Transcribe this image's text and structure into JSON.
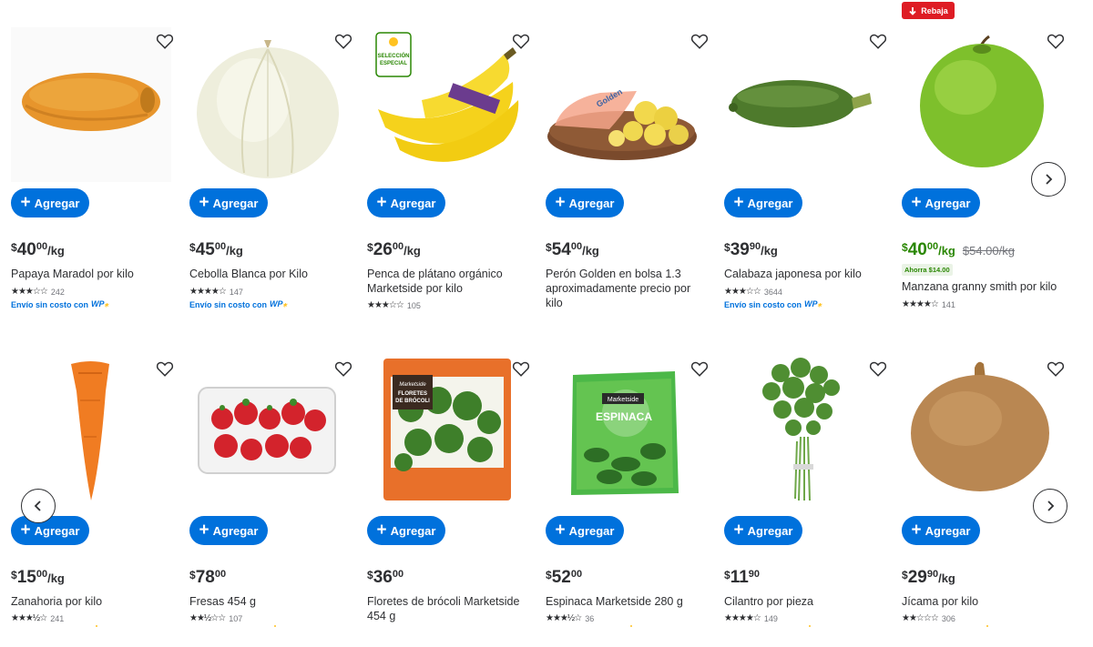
{
  "add_label": "Agregar",
  "rebaja_label": "Rebaja",
  "shipping_label": "Envío sin costo con",
  "wplus_label": "W+",
  "colors": {
    "accent": "#0071dc",
    "sale": "#2a8703",
    "badge": "#de1c24",
    "text": "#2e2f32"
  },
  "row1": [
    {
      "name": "Papaya Maradol por kilo",
      "price_int": "40",
      "price_cents": "00",
      "unit": "/kg",
      "rating": 3,
      "reviews": "242",
      "shipping": true
    },
    {
      "name": "Cebolla Blanca por Kilo",
      "price_int": "45",
      "price_cents": "00",
      "unit": "/kg",
      "rating": 4,
      "reviews": "147",
      "shipping": true
    },
    {
      "name": "Penca de plátano orgánico Marketside por kilo",
      "price_int": "26",
      "price_cents": "00",
      "unit": "/kg",
      "rating": 3,
      "reviews": "105",
      "badge": "SELECCIÓN ESPECIAL"
    },
    {
      "name": "Perón Golden en bolsa 1.3 aproximadamente precio por kilo",
      "price_int": "54",
      "price_cents": "00",
      "unit": "/kg"
    },
    {
      "name": "Calabaza japonesa por kilo",
      "price_int": "39",
      "price_cents": "90",
      "unit": "/kg",
      "rating": 3,
      "reviews": "3644",
      "shipping": true
    },
    {
      "name": "Manzana granny smith por kilo",
      "price_int": "40",
      "price_cents": "00",
      "unit": "/kg",
      "was": "$54.00/kg",
      "savings": "Ahorra $14.00",
      "rating": 4,
      "reviews": "141"
    }
  ],
  "row2": [
    {
      "name": "Zanahoria por kilo",
      "price_int": "15",
      "price_cents": "00",
      "unit": "/kg",
      "rating": 3.5,
      "reviews": "241"
    },
    {
      "name": "Fresas 454 g",
      "price_int": "78",
      "price_cents": "00",
      "unit": "",
      "rating": 2.5,
      "reviews": "107"
    },
    {
      "name": "Floretes de brócoli Marketside 454 g",
      "price_int": "36",
      "price_cents": "00",
      "unit": ""
    },
    {
      "name": "Espinaca Marketside 280 g",
      "price_int": "52",
      "price_cents": "00",
      "unit": "",
      "rating": 3.5,
      "reviews": "36"
    },
    {
      "name": "Cilantro por pieza",
      "price_int": "11",
      "price_cents": "90",
      "unit": "",
      "rating": 4,
      "reviews": "149"
    },
    {
      "name": "Jícama por kilo",
      "price_int": "29",
      "price_cents": "90",
      "unit": "/kg",
      "rating": 2,
      "reviews": "306"
    }
  ],
  "package_text": {
    "bananas_badge_1": "SELECCIÓN",
    "bananas_badge_2": "ESPECIAL",
    "broccoli_brand": "Marketside",
    "broccoli_title_1": "FLORETES",
    "broccoli_title_2": "DE BRÓCOLI",
    "spinach_brand": "Marketside",
    "spinach_title": "ESPINACA",
    "apples_brand": "Golden"
  }
}
